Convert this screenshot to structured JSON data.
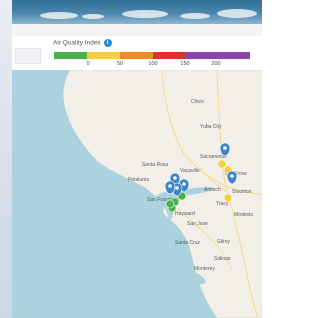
{
  "aqi_legend": {
    "title": "Air Quality Index",
    "info_icon": "info-icon",
    "segments": [
      {
        "color": "#4cae4c",
        "range": "0-50"
      },
      {
        "color": "#f4d03f",
        "range": "50-100"
      },
      {
        "color": "#f08a24",
        "range": "100-150"
      },
      {
        "color": "#e0312f",
        "range": "150-200"
      },
      {
        "color": "#8e44ad",
        "range": "200+"
      }
    ],
    "ticks": [
      "0",
      "50",
      "100",
      "150",
      "200"
    ]
  },
  "map": {
    "cities": [
      {
        "name": "Chico"
      },
      {
        "name": "Yuba City"
      },
      {
        "name": "Sacramento"
      },
      {
        "name": "Santa Rosa"
      },
      {
        "name": "Vacaville"
      },
      {
        "name": "Elk Grove"
      },
      {
        "name": "Petaluma"
      },
      {
        "name": "Stockton"
      },
      {
        "name": "Antioch"
      },
      {
        "name": "San Francisco"
      },
      {
        "name": "Tracy"
      },
      {
        "name": "Hayward"
      },
      {
        "name": "Modesto"
      },
      {
        "name": "San Jose"
      },
      {
        "name": "Santa Cruz"
      },
      {
        "name": "Gilroy"
      },
      {
        "name": "Salinas"
      },
      {
        "name": "Monterey"
      }
    ],
    "markers": [
      {
        "icon": "map-pin-icon",
        "color": "#3d85c6"
      },
      {
        "icon": "map-pin-icon",
        "color": "#3d85c6"
      },
      {
        "icon": "map-pin-icon",
        "color": "#3d85c6"
      },
      {
        "icon": "map-pin-icon",
        "color": "#3d85c6"
      },
      {
        "icon": "map-pin-icon",
        "color": "#3d85c6"
      },
      {
        "icon": "map-pin-icon",
        "color": "#3d85c6"
      }
    ],
    "aqi_dots": [
      {
        "color": "#f4d03f"
      },
      {
        "color": "#f4d03f"
      },
      {
        "color": "#f4d03f"
      },
      {
        "color": "#4cae4c"
      },
      {
        "color": "#4cae4c"
      },
      {
        "color": "#4cae4c"
      },
      {
        "color": "#4cae4c"
      }
    ]
  }
}
